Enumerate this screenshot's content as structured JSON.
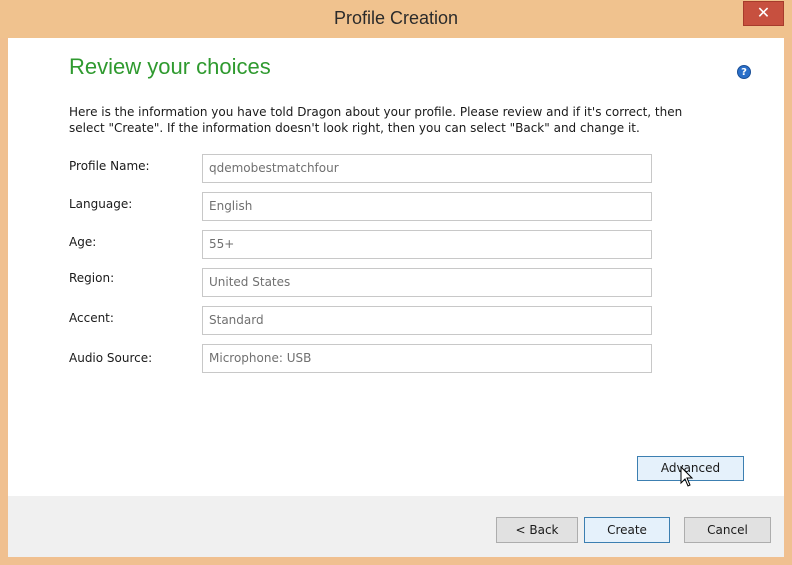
{
  "window": {
    "title": "Profile Creation",
    "close_glyph": "✕"
  },
  "page": {
    "heading": "Review your choices",
    "help_glyph": "?",
    "intro_line1": "Here is the information you have told Dragon about your profile.  Please review and if it's correct, then",
    "intro_line2": "select \"Create\".  If the information doesn't look right, then you can select \"Back\" and change it."
  },
  "fields": [
    {
      "label": "Profile Name:",
      "value": "qdemobestmatchfour"
    },
    {
      "label": "Language:",
      "value": "English"
    },
    {
      "label": "Age:",
      "value": "55+"
    },
    {
      "label": "Region:",
      "value": "United States"
    },
    {
      "label": "Accent:",
      "value": "Standard"
    },
    {
      "label": "Audio Source:",
      "value": "Microphone: USB"
    }
  ],
  "buttons": {
    "advanced": "Advanced",
    "back": "< Back",
    "create": "Create",
    "cancel": "Cancel"
  },
  "colors": {
    "heading": "#2f9a2f",
    "titlebar": "#f0c28e",
    "close": "#c7503f"
  }
}
